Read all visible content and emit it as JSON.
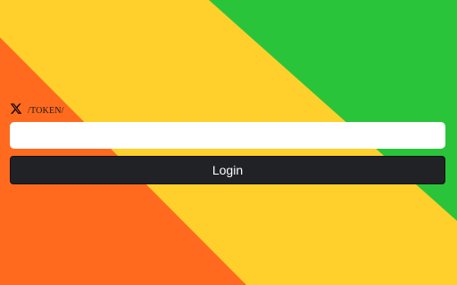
{
  "colors": {
    "orange": "#FF6A1F",
    "yellow": "#FFD02B",
    "green": "#2AC43B",
    "button": "#212226"
  },
  "login": {
    "icon": "x-logo-icon",
    "token_label": "/TOKEN/",
    "token_value": "",
    "button_label": "Login"
  }
}
